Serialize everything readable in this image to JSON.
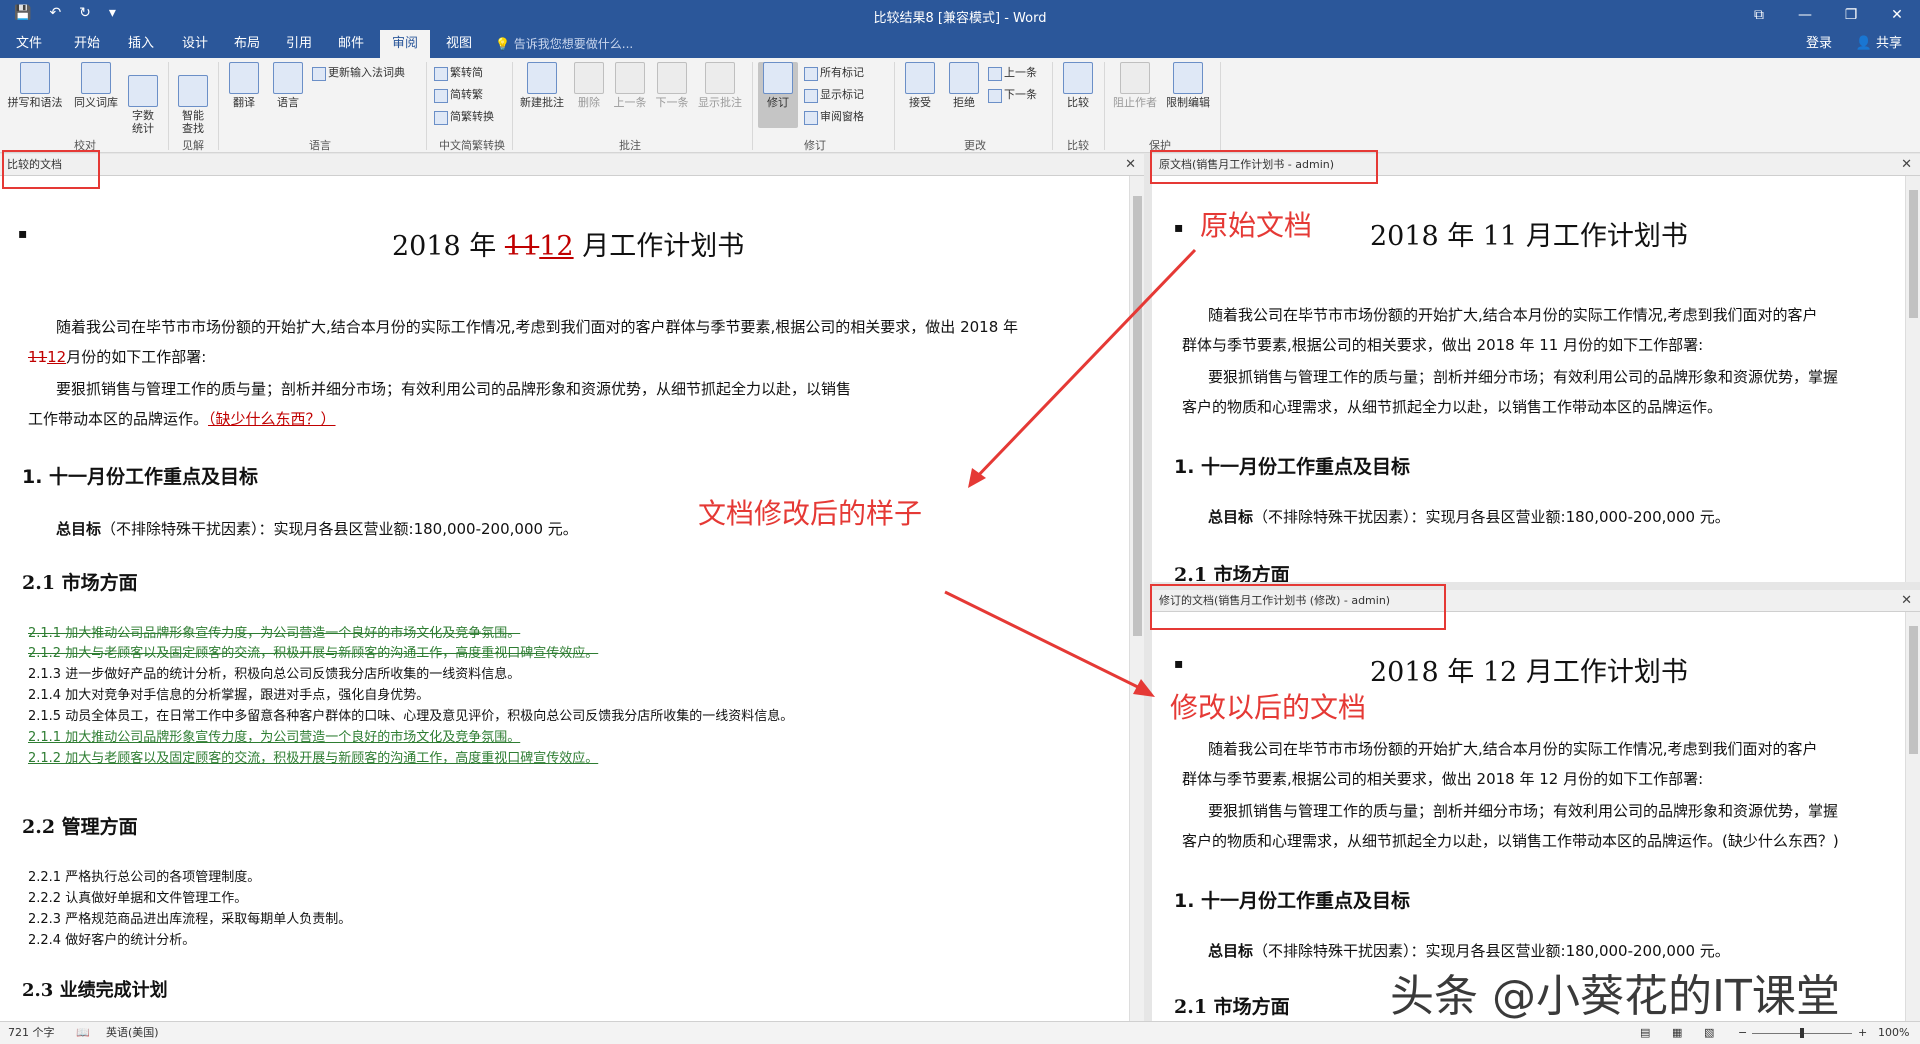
{
  "window": {
    "title": "比较结果8 [兼容模式] - Word",
    "controls": [
      "⧉",
      "—",
      "❐",
      "✕"
    ]
  },
  "quick_access": {
    "save": "💾",
    "undo": "↶",
    "redo": "↻",
    "customize": "▾"
  },
  "tabs": [
    {
      "label": "文件"
    },
    {
      "label": "开始"
    },
    {
      "label": "插入"
    },
    {
      "label": "设计"
    },
    {
      "label": "布局"
    },
    {
      "label": "引用"
    },
    {
      "label": "邮件"
    },
    {
      "label": "审阅"
    },
    {
      "label": "视图"
    }
  ],
  "tell_me": "告诉我您想要做什么...",
  "account": {
    "login": "登录",
    "share": "共享"
  },
  "ribbon": {
    "proofing": {
      "spell": "拼写和语法",
      "thesaurus": "同义词库",
      "wordcount": "字数\n统计",
      "label": "校对"
    },
    "insights": {
      "smart": "智能\n查找",
      "label": "见解"
    },
    "language": {
      "translate": "翻译",
      "language": "语言",
      "ime": "更新输入法词典",
      "label": "语言"
    },
    "chinese": {
      "t2s": "繁转简",
      "s2t": "简转繁",
      "conv": "简繁转换",
      "label": "中文简繁转换"
    },
    "comments": {
      "new": "新建批注",
      "delete": "删除",
      "prev": "上一条",
      "next": "下一条",
      "show": "显示批注",
      "label": "批注"
    },
    "tracking": {
      "track": "修订",
      "markup": "所有标记",
      "showmarkup": "显示标记",
      "pane": "审阅窗格",
      "label": "修订"
    },
    "changes": {
      "accept": "接受",
      "reject": "拒绝",
      "prev": "上一条",
      "next": "下一条",
      "label": "更改"
    },
    "compare": {
      "compare": "比较",
      "label": "比较"
    },
    "protect": {
      "block": "阻止作者",
      "restrict": "限制编辑",
      "label": "保护"
    }
  },
  "left_pane": {
    "header": "比较的文档",
    "title_pre": "2018 年 ",
    "title_del": "11",
    "title_ins": "12",
    "title_post": " 月工作计划书",
    "para1a": "随着我公司在毕节市市场份额的开始扩大,结合本月份的实际工作情况,考虑到我们面对的客户群体与季节要素,根据公司的相关要求，做出 2018 年",
    "para1b_del": "11",
    "para1b_ins": "12",
    "para1b_rest": "月份的如下工作部署:",
    "para2a": "要狠抓销售与管理工作的质与量；剖析并细分市场；有效利用公司的品牌形象和资源优势，从细节抓起全力以赴，以销售",
    "para2b": "工作带动本区的品牌运作。",
    "para2b_ins": "（缺少什么东西？）",
    "h1": "1. 十一月份工作重点及目标",
    "goal_bold": "总目标",
    "goal_rest": "（不排除特殊干扰因素）：实现月各县区营业额:180,000-200,000 元。",
    "h21": "2.1  市场方面",
    "list_del": [
      "2.1.1  加大推动公司品牌形象宣传力度，为公司营造一个良好的市场文化及竞争氛围。",
      "2.1.2  加大与老顾客以及固定顾客的交流，积极开展与新顾客的沟通工作，高度重视口碑宣传效应。"
    ],
    "list_plain": [
      "2.1.3  进一步做好产品的统计分析，积极向总公司反馈我分店所收集的一线资料信息。",
      "2.1.4  加大对竞争对手信息的分析掌握，跟进对手点，强化自身优势。",
      "2.1.5  动员全体员工，在日常工作中多留意各种客户群体的口味、心理及意见评价，积极向总公司反馈我分店所收集的一线资料信息。"
    ],
    "list_ins": [
      "2.1.1  加大推动公司品牌形象宣传力度，为公司营造一个良好的市场文化及竞争氛围。",
      "2.1.2  加大与老顾客以及固定顾客的交流，积极开展与新顾客的沟通工作，高度重视口碑宣传效应。"
    ],
    "h22": "2.2  管理方面",
    "list22": [
      "2.2.1  严格执行总公司的各项管理制度。",
      "2.2.2  认真做好单据和文件管理工作。",
      "2.2.3  严格规范商品进出库流程，采取每期单人负责制。",
      "2.2.4  做好客户的统计分析。"
    ],
    "h23": "2.3  业绩完成计划"
  },
  "orig_pane": {
    "header": "原文档(销售月工作计划书 - admin)",
    "title": "2018 年 11 月工作计划书",
    "para1a": "随着我公司在毕节市市场份额的开始扩大,结合本月份的实际工作情况,考虑到我们面对的客户",
    "para1b": "群体与季节要素,根据公司的相关要求，做出 2018 年 11 月份的如下工作部署:",
    "para2a": "要狠抓销售与管理工作的质与量；剖析并细分市场；有效利用公司的品牌形象和资源优势，掌握",
    "para2b": "客户的物质和心理需求，从细节抓起全力以赴，以销售工作带动本区的品牌运作。",
    "h1": "1. 十一月份工作重点及目标",
    "goal_bold": "总目标",
    "goal_rest": "（不排除特殊干扰因素）：实现月各县区营业额:180,000-200,000 元。",
    "h21": "2.1  市场方面"
  },
  "rev_pane": {
    "header": "修订的文档(销售月工作计划书 (修改) - admin)",
    "title": "2018 年 12 月工作计划书",
    "para1a": "随着我公司在毕节市市场份额的开始扩大,结合本月份的实际工作情况,考虑到我们面对的客户",
    "para1b": "群体与季节要素,根据公司的相关要求，做出 2018 年 12 月份的如下工作部署:",
    "para2a": "要狠抓销售与管理工作的质与量；剖析并细分市场；有效利用公司的品牌形象和资源优势，掌握",
    "para2b": "客户的物质和心理需求，从细节抓起全力以赴，以销售工作带动本区的品牌运作。(缺少什么东西？)",
    "h1": "1. 十一月份工作重点及目标",
    "goal_bold": "总目标",
    "goal_rest": "（不排除特殊干扰因素）：实现月各县区营业额:180,000-200,000 元。",
    "h21": "2.1  市场方面"
  },
  "annotations": {
    "original": "原始文档",
    "modified": "文档修改后的样子",
    "revised": "修改以后的文档",
    "color": "#e53935"
  },
  "status": {
    "words": "721 个字",
    "lang": "英语(美国)",
    "zoom": "100%",
    "zoom_minus": "−",
    "zoom_plus": "+"
  },
  "watermark": "头条 @小葵花的IT课堂",
  "colors": {
    "brand": "#2b579a",
    "deletion": "#c00000",
    "moved": "#2e7d32"
  }
}
